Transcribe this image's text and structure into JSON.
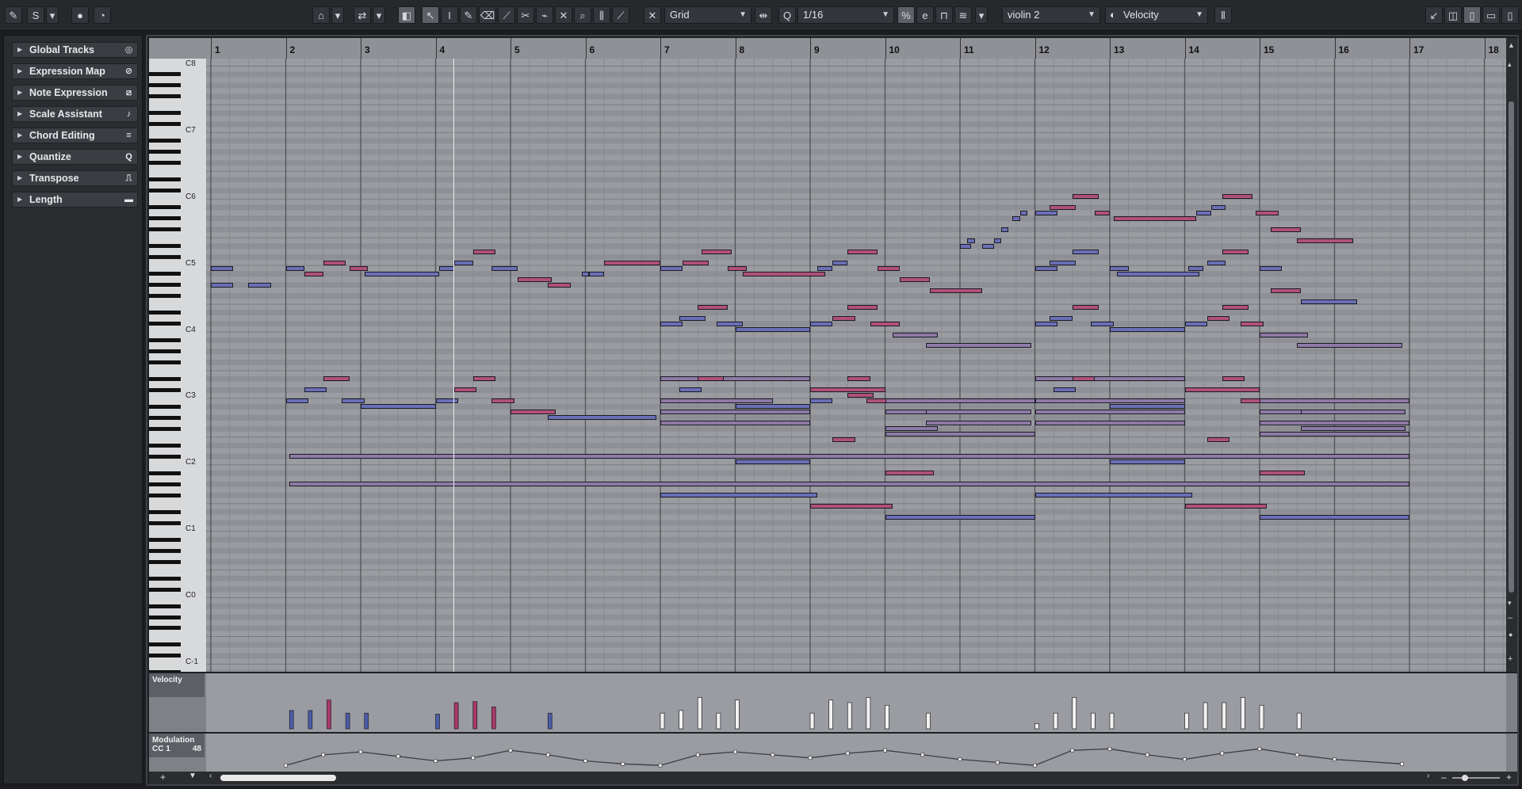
{
  "toolbar": {
    "grid_label": "Grid",
    "quantize_value": "1/16",
    "track_name": "violin 2",
    "lane_type": "Velocity"
  },
  "inspector": {
    "items": [
      {
        "label": "Global Tracks",
        "icon": "target-icon"
      },
      {
        "label": "Expression Map",
        "icon": "link-icon"
      },
      {
        "label": "Note Expression",
        "icon": "slash-box-icon"
      },
      {
        "label": "Scale Assistant",
        "icon": "note-step-icon"
      },
      {
        "label": "Chord Editing",
        "icon": "chord-stack-icon"
      },
      {
        "label": "Quantize",
        "icon": "quantize-q-icon"
      },
      {
        "label": "Transpose",
        "icon": "transpose-icon"
      },
      {
        "label": "Length",
        "icon": "length-icon"
      }
    ]
  },
  "ruler": {
    "bars": [
      "1",
      "2",
      "3",
      "4",
      "5",
      "6",
      "7",
      "8",
      "9",
      "10",
      "11",
      "12",
      "13",
      "14",
      "15",
      "16",
      "17",
      "18"
    ]
  },
  "keyboard": {
    "c_labels": [
      "C8",
      "C7",
      "C6",
      "C5",
      "C4",
      "C3",
      "C2",
      "C1",
      "C0",
      "C-1"
    ]
  },
  "lanes": {
    "velocity_label": "Velocity",
    "modulation_label": "Modulation",
    "cc_label": "CC 1",
    "cc_value": "48"
  },
  "colors": {
    "note_blue": "#6a6fb6",
    "note_mixed": "#8e7aa6",
    "note_red": "#b0507a",
    "grid_bg": "#9a9ca1",
    "grid_black_row": "#8e9095"
  }
}
